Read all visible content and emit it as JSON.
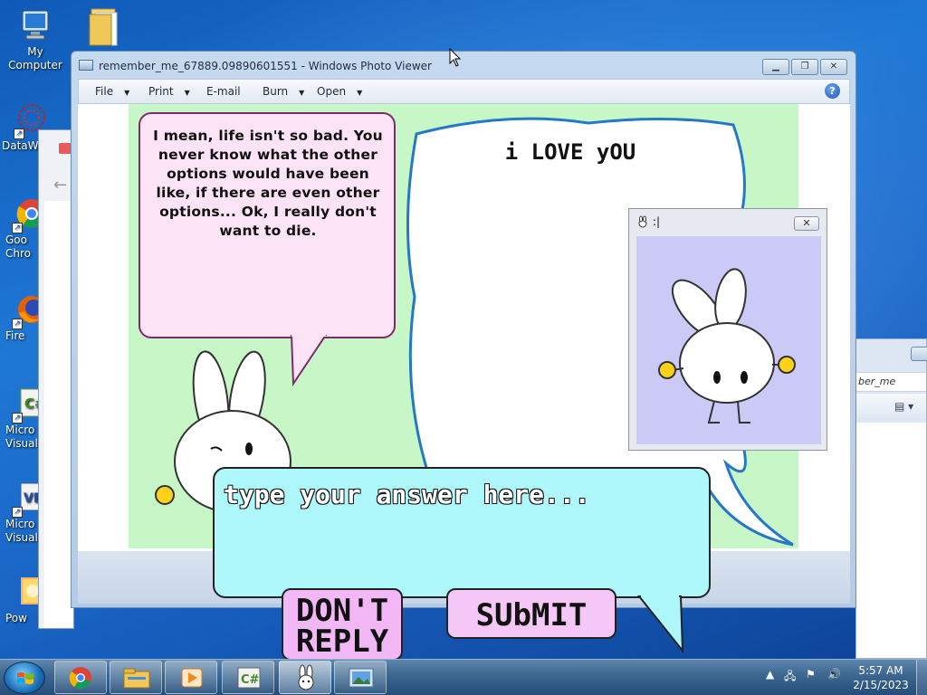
{
  "desktop": {
    "icons": [
      {
        "label": "My Computer",
        "icon": "computer-icon"
      },
      {
        "label": "",
        "icon": "folder-icon"
      },
      {
        "label": "DataWa",
        "icon": "datawarrior-icon"
      },
      {
        "label": "Goo",
        "label2": "Chro",
        "icon": "chrome-icon"
      },
      {
        "label": "Fire",
        "icon": "firefox-icon"
      },
      {
        "label": "Micro",
        "label2": "Visual",
        "icon": "visual-csharp-icon"
      },
      {
        "label": "Micro",
        "label2": "Visual",
        "icon": "visual-basic-icon"
      },
      {
        "label": "Pow",
        "icon": "powerpoint-icon"
      }
    ]
  },
  "photo_viewer": {
    "title": "remember_me_67889.09890601551 - Windows Photo Viewer",
    "menu": [
      "File",
      "Print",
      "E-mail",
      "Burn",
      "Open"
    ],
    "help": "?"
  },
  "game": {
    "pink_bubble": "I mean, life isn't so bad. You never know what the other options would have been like, if there are even other options... Ok, I really don't want to die.",
    "white_bubble": "i LOVE yOU",
    "answer_placeholder": "type your answer here...",
    "dont_reply": "DON'T REPLY",
    "submit": "SUbMIT"
  },
  "popup": {
    "title": ":|",
    "close": "✕"
  },
  "background_window": {
    "address_fragment": "ber_me"
  },
  "taskbar": {
    "items": [
      "chrome-icon",
      "explorer-icon",
      "media-player-icon",
      "csharp-app-icon",
      "bunny-app-icon",
      "photo-viewer-icon"
    ],
    "active_index": 4
  },
  "clock": {
    "time": "5:57 AM",
    "date": "2/15/2023"
  }
}
